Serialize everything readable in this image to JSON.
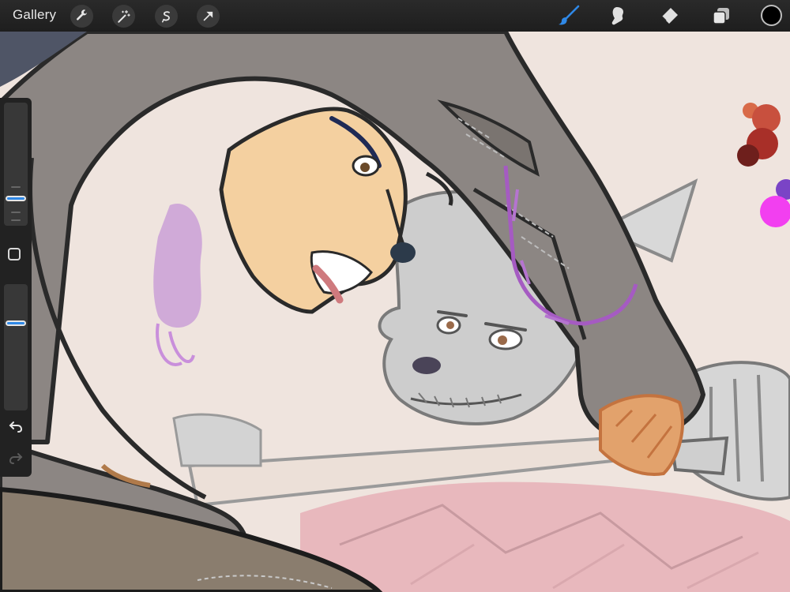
{
  "topbar": {
    "gallery_label": "Gallery",
    "left_tools": [
      "wrench-icon",
      "magic-wand-icon",
      "selection-icon",
      "transform-arrow-icon"
    ],
    "right_tools": [
      "brush-icon",
      "smudge-icon",
      "eraser-icon",
      "layers-icon"
    ],
    "active_tool": "brush-icon",
    "active_tool_color": "#2f88e6",
    "current_color": "#000000"
  },
  "sidebar": {
    "brush_size_level": 0.25,
    "brush_opacity_level": 0.35,
    "accent": "#2f88e6",
    "buttons": [
      "modifier-square-icon",
      "undo-icon",
      "redo-icon"
    ]
  },
  "canvas": {
    "description_palette": [
      "#c8503e",
      "#a82f28",
      "#6e1f1c",
      "#7a44c6",
      "#f23ff0"
    ]
  }
}
